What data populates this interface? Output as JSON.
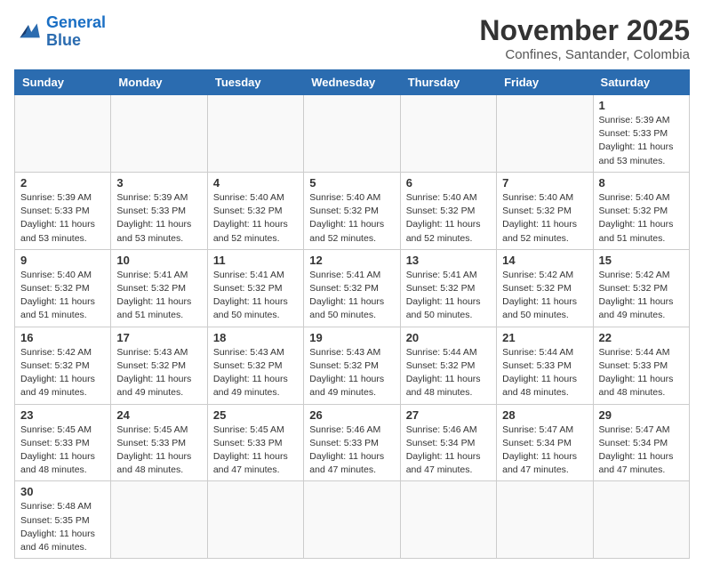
{
  "logo": {
    "general": "General",
    "blue": "Blue"
  },
  "title": "November 2025",
  "location": "Confines, Santander, Colombia",
  "days_header": [
    "Sunday",
    "Monday",
    "Tuesday",
    "Wednesday",
    "Thursday",
    "Friday",
    "Saturday"
  ],
  "weeks": [
    [
      {
        "day": "",
        "info": ""
      },
      {
        "day": "",
        "info": ""
      },
      {
        "day": "",
        "info": ""
      },
      {
        "day": "",
        "info": ""
      },
      {
        "day": "",
        "info": ""
      },
      {
        "day": "",
        "info": ""
      },
      {
        "day": "1",
        "info": "Sunrise: 5:39 AM\nSunset: 5:33 PM\nDaylight: 11 hours\nand 53 minutes."
      }
    ],
    [
      {
        "day": "2",
        "info": "Sunrise: 5:39 AM\nSunset: 5:33 PM\nDaylight: 11 hours\nand 53 minutes."
      },
      {
        "day": "3",
        "info": "Sunrise: 5:39 AM\nSunset: 5:33 PM\nDaylight: 11 hours\nand 53 minutes."
      },
      {
        "day": "4",
        "info": "Sunrise: 5:40 AM\nSunset: 5:32 PM\nDaylight: 11 hours\nand 52 minutes."
      },
      {
        "day": "5",
        "info": "Sunrise: 5:40 AM\nSunset: 5:32 PM\nDaylight: 11 hours\nand 52 minutes."
      },
      {
        "day": "6",
        "info": "Sunrise: 5:40 AM\nSunset: 5:32 PM\nDaylight: 11 hours\nand 52 minutes."
      },
      {
        "day": "7",
        "info": "Sunrise: 5:40 AM\nSunset: 5:32 PM\nDaylight: 11 hours\nand 52 minutes."
      },
      {
        "day": "8",
        "info": "Sunrise: 5:40 AM\nSunset: 5:32 PM\nDaylight: 11 hours\nand 51 minutes."
      }
    ],
    [
      {
        "day": "9",
        "info": "Sunrise: 5:40 AM\nSunset: 5:32 PM\nDaylight: 11 hours\nand 51 minutes."
      },
      {
        "day": "10",
        "info": "Sunrise: 5:41 AM\nSunset: 5:32 PM\nDaylight: 11 hours\nand 51 minutes."
      },
      {
        "day": "11",
        "info": "Sunrise: 5:41 AM\nSunset: 5:32 PM\nDaylight: 11 hours\nand 50 minutes."
      },
      {
        "day": "12",
        "info": "Sunrise: 5:41 AM\nSunset: 5:32 PM\nDaylight: 11 hours\nand 50 minutes."
      },
      {
        "day": "13",
        "info": "Sunrise: 5:41 AM\nSunset: 5:32 PM\nDaylight: 11 hours\nand 50 minutes."
      },
      {
        "day": "14",
        "info": "Sunrise: 5:42 AM\nSunset: 5:32 PM\nDaylight: 11 hours\nand 50 minutes."
      },
      {
        "day": "15",
        "info": "Sunrise: 5:42 AM\nSunset: 5:32 PM\nDaylight: 11 hours\nand 49 minutes."
      }
    ],
    [
      {
        "day": "16",
        "info": "Sunrise: 5:42 AM\nSunset: 5:32 PM\nDaylight: 11 hours\nand 49 minutes."
      },
      {
        "day": "17",
        "info": "Sunrise: 5:43 AM\nSunset: 5:32 PM\nDaylight: 11 hours\nand 49 minutes."
      },
      {
        "day": "18",
        "info": "Sunrise: 5:43 AM\nSunset: 5:32 PM\nDaylight: 11 hours\nand 49 minutes."
      },
      {
        "day": "19",
        "info": "Sunrise: 5:43 AM\nSunset: 5:32 PM\nDaylight: 11 hours\nand 49 minutes."
      },
      {
        "day": "20",
        "info": "Sunrise: 5:44 AM\nSunset: 5:32 PM\nDaylight: 11 hours\nand 48 minutes."
      },
      {
        "day": "21",
        "info": "Sunrise: 5:44 AM\nSunset: 5:33 PM\nDaylight: 11 hours\nand 48 minutes."
      },
      {
        "day": "22",
        "info": "Sunrise: 5:44 AM\nSunset: 5:33 PM\nDaylight: 11 hours\nand 48 minutes."
      }
    ],
    [
      {
        "day": "23",
        "info": "Sunrise: 5:45 AM\nSunset: 5:33 PM\nDaylight: 11 hours\nand 48 minutes."
      },
      {
        "day": "24",
        "info": "Sunrise: 5:45 AM\nSunset: 5:33 PM\nDaylight: 11 hours\nand 48 minutes."
      },
      {
        "day": "25",
        "info": "Sunrise: 5:45 AM\nSunset: 5:33 PM\nDaylight: 11 hours\nand 47 minutes."
      },
      {
        "day": "26",
        "info": "Sunrise: 5:46 AM\nSunset: 5:33 PM\nDaylight: 11 hours\nand 47 minutes."
      },
      {
        "day": "27",
        "info": "Sunrise: 5:46 AM\nSunset: 5:34 PM\nDaylight: 11 hours\nand 47 minutes."
      },
      {
        "day": "28",
        "info": "Sunrise: 5:47 AM\nSunset: 5:34 PM\nDaylight: 11 hours\nand 47 minutes."
      },
      {
        "day": "29",
        "info": "Sunrise: 5:47 AM\nSunset: 5:34 PM\nDaylight: 11 hours\nand 47 minutes."
      }
    ],
    [
      {
        "day": "30",
        "info": "Sunrise: 5:48 AM\nSunset: 5:35 PM\nDaylight: 11 hours\nand 46 minutes."
      },
      {
        "day": "",
        "info": ""
      },
      {
        "day": "",
        "info": ""
      },
      {
        "day": "",
        "info": ""
      },
      {
        "day": "",
        "info": ""
      },
      {
        "day": "",
        "info": ""
      },
      {
        "day": "",
        "info": ""
      }
    ]
  ]
}
